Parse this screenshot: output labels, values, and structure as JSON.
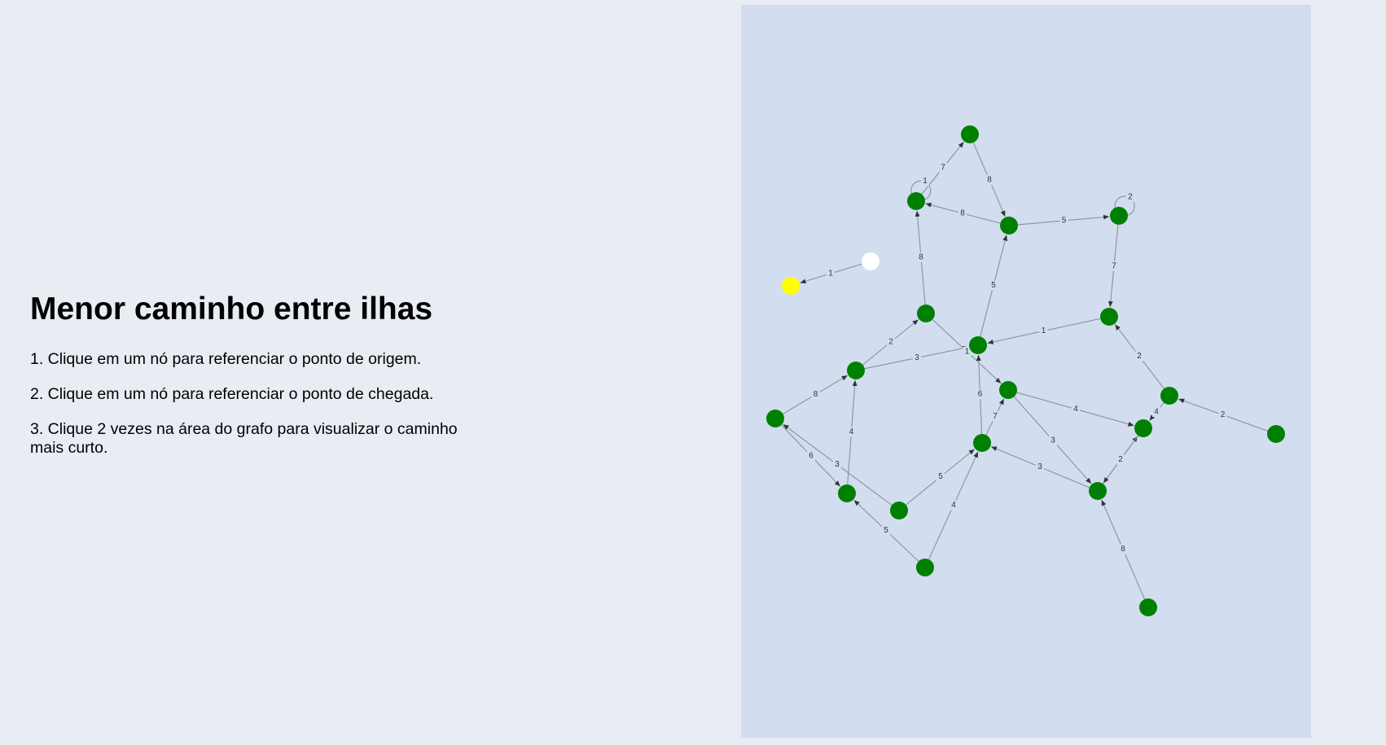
{
  "intro": {
    "title": "Menor caminho entre ilhas",
    "steps": [
      "1. Clique em um nó para referenciar o ponto de origem.",
      "2. Clique em um nó para referenciar o ponto de chegada.",
      "3. Clique 2 vezes na área do grafo para visualizar o caminho mais curto."
    ]
  },
  "graph": {
    "colors": {
      "panel_background": "#d2deef",
      "node_default": "#008000",
      "node_origin": "#ffff00",
      "node_destination": "#ffffff",
      "edge": "#8d97a6",
      "edge_label": "#333333"
    },
    "nodes": [
      {
        "id": "n1",
        "state": "default"
      },
      {
        "id": "n2",
        "state": "default"
      },
      {
        "id": "n3",
        "state": "default"
      },
      {
        "id": "n4",
        "state": "default"
      },
      {
        "id": "n5",
        "state": "destination"
      },
      {
        "id": "n6",
        "state": "origin"
      },
      {
        "id": "n7",
        "state": "default"
      },
      {
        "id": "n8",
        "state": "default"
      },
      {
        "id": "n9",
        "state": "default"
      },
      {
        "id": "n10",
        "state": "default"
      },
      {
        "id": "n11",
        "state": "default"
      },
      {
        "id": "n12",
        "state": "default"
      },
      {
        "id": "n13",
        "state": "default"
      },
      {
        "id": "n14",
        "state": "default"
      },
      {
        "id": "n15",
        "state": "default"
      },
      {
        "id": "n16",
        "state": "default"
      },
      {
        "id": "n17",
        "state": "default"
      },
      {
        "id": "n18",
        "state": "default"
      },
      {
        "id": "n19",
        "state": "default"
      },
      {
        "id": "n20",
        "state": "default"
      },
      {
        "id": "n21",
        "state": "default"
      },
      {
        "id": "n22",
        "state": "default"
      }
    ],
    "edges": [
      {
        "from": "n2",
        "to": "n1",
        "weight": "7"
      },
      {
        "from": "n1",
        "to": "n3",
        "weight": "8"
      },
      {
        "from": "n2",
        "to": "n2",
        "weight": "1"
      },
      {
        "from": "n3",
        "to": "n2",
        "weight": "8"
      },
      {
        "from": "n3",
        "to": "n4",
        "weight": "5"
      },
      {
        "from": "n4",
        "to": "n4",
        "weight": "2"
      },
      {
        "from": "n5",
        "to": "n6",
        "weight": "1"
      },
      {
        "from": "n7",
        "to": "n2",
        "weight": "8"
      },
      {
        "from": "n9",
        "to": "n3",
        "weight": "5"
      },
      {
        "from": "n4",
        "to": "n8",
        "weight": "7"
      },
      {
        "from": "n8",
        "to": "n9",
        "weight": "1"
      },
      {
        "from": "n10",
        "to": "n7",
        "weight": "2"
      },
      {
        "from": "n10",
        "to": "n9",
        "weight": "3"
      },
      {
        "from": "n7",
        "to": "n11",
        "weight": "1"
      },
      {
        "from": "n12",
        "to": "n8",
        "weight": "2"
      },
      {
        "from": "n12",
        "to": "n13",
        "weight": "4"
      },
      {
        "from": "n19",
        "to": "n13",
        "weight": "8"
      },
      {
        "from": "n11",
        "to": "n13",
        "weight": "4"
      },
      {
        "from": "n22",
        "to": "n12",
        "weight": "2"
      },
      {
        "from": "n14",
        "to": "n10",
        "weight": "8"
      },
      {
        "from": "n14",
        "to": "n16",
        "weight": "6"
      },
      {
        "from": "n17",
        "to": "n14",
        "weight": "3"
      },
      {
        "from": "n16",
        "to": "n10",
        "weight": "4"
      },
      {
        "from": "n17",
        "to": "n15",
        "weight": "5"
      },
      {
        "from": "n18",
        "to": "n15",
        "weight": "4"
      },
      {
        "from": "n18",
        "to": "n16",
        "weight": "5"
      },
      {
        "from": "n15",
        "to": "n9",
        "weight": "6"
      },
      {
        "from": "n15",
        "to": "n11",
        "weight": "7"
      },
      {
        "from": "n19",
        "to": "n15",
        "weight": "3"
      },
      {
        "from": "n11",
        "to": "n19",
        "weight": "3"
      },
      {
        "from": "n13",
        "to": "n19",
        "weight": "2"
      },
      {
        "from": "n20",
        "to": "n19",
        "weight": "8"
      }
    ]
  }
}
